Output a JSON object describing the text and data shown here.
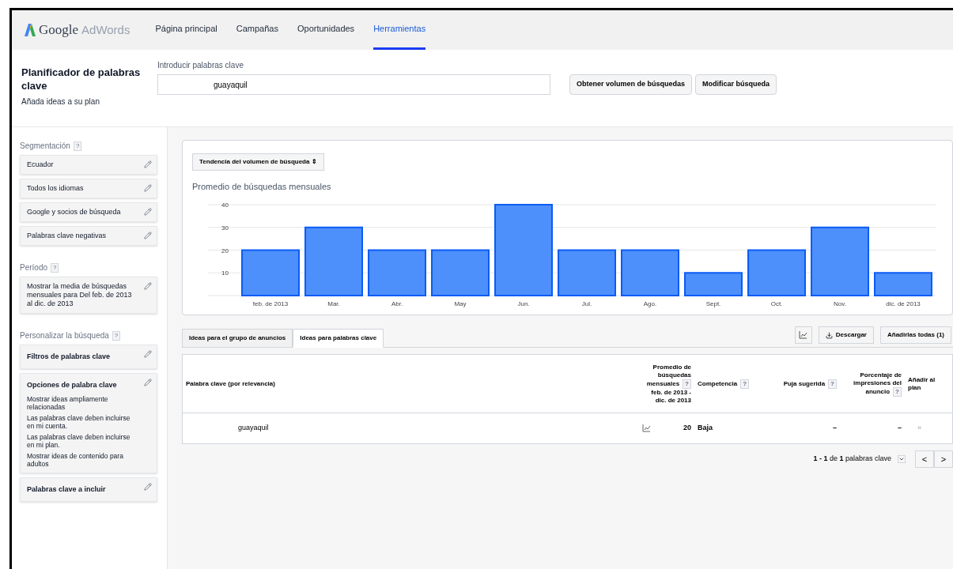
{
  "header": {
    "logo_google": "Google",
    "logo_product": "AdWords",
    "nav": [
      {
        "label": "Página principal",
        "selected": false
      },
      {
        "label": "Campañas",
        "selected": false
      },
      {
        "label": "Oportunidades",
        "selected": false
      },
      {
        "label": "Herramientas",
        "selected": true
      }
    ]
  },
  "planner": {
    "title": "Planificador de palabras clave",
    "subtitle": "Añada ideas a su plan",
    "input_label": "Introducir palabras clave",
    "input_value": "guayaquil",
    "buttons": [
      "Obtener volumen de búsquedas",
      "Modificar búsqueda"
    ]
  },
  "sidebar": [
    {
      "title": "Segmentación",
      "help": "?",
      "items": [
        {
          "title": "Ecuador",
          "kind": "plain"
        },
        {
          "title": "Todos los idiomas",
          "kind": "plain"
        },
        {
          "title": "Google y socios de búsqueda",
          "kind": "plain"
        },
        {
          "title": "Palabras clave negativas",
          "kind": "plain"
        }
      ]
    },
    {
      "title": "Período",
      "help": "?",
      "items": [
        {
          "title": "Mostrar la media de búsquedas mensuales para Del feb. de 2013 al dic. de 2013",
          "kind": "plain"
        }
      ]
    },
    {
      "title": "Personalizar la búsqueda",
      "help": "?",
      "items": [
        {
          "title": "Filtros de palabras clave",
          "kind": "heading"
        },
        {
          "title": "Opciones de palabra clave",
          "kind": "heading",
          "details": [
            "Mostrar ideas ampliamente relacionadas",
            "Las palabras clave deben incluirse en mi cuenta.",
            "Las palabras clave deben incluirse en mi plan.",
            "Mostrar ideas de contenido para adultos"
          ]
        },
        {
          "title": "Palabras clave a incluir",
          "kind": "heading"
        }
      ]
    }
  ],
  "chart_panel": {
    "selector": "Tendencia del volumen de búsqueda",
    "selector_arrows": "⇕",
    "chart_data": {
      "type": "bar",
      "title": "Promedio de búsquedas mensuales",
      "categories": [
        "feb. de 2013",
        "Mar.",
        "Abr.",
        "May",
        "Jun.",
        "Jul.",
        "Ago.",
        "Sept.",
        "Oct.",
        "Nov.",
        "dic. de 2013"
      ],
      "series": [
        {
          "color": "#4d8ffb",
          "values": [
            20,
            30,
            20,
            20,
            40,
            20,
            20,
            10,
            20,
            30,
            10
          ]
        }
      ],
      "ylim": [
        0,
        40
      ],
      "yticks": [
        10,
        20,
        30,
        40
      ],
      "grid": true
    }
  },
  "tabs": [
    {
      "label": "Ideas para el grupo de anuncios",
      "selected": false
    },
    {
      "label": "Ideas para palabras clave",
      "selected": true
    }
  ],
  "tab_actions": [
    "Descargar",
    "Añadirlas todas (1)"
  ],
  "table": {
    "columns": [
      {
        "label": "Palabra clave (por relevancia)"
      },
      {
        "label": "Promedio de búsquedas mensuales",
        "help": "?",
        "extra": "feb. de 2013 - dic. de 2013"
      },
      {
        "label": "Competencia",
        "help": "?"
      },
      {
        "label": "Puja sugerida",
        "help": "?"
      },
      {
        "label": "Porcentaje de impresiones del anuncio",
        "help": "?"
      },
      {
        "label": "Añadir al plan"
      }
    ],
    "rows": [
      {
        "keyword": "guayaquil",
        "searches": "20",
        "competition": "Baja",
        "bid": "–",
        "impressions": "–",
        "add": "»"
      }
    ]
  },
  "pagination": {
    "text": "**1 - 1** de **1** palabras clave",
    "prev": "<",
    "next": ">"
  }
}
